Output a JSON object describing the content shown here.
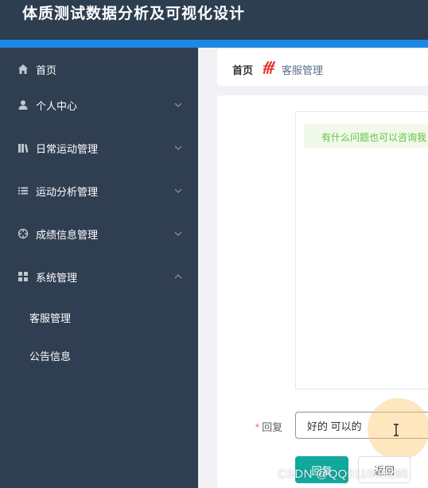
{
  "header": {
    "title": "体质测试数据分析及可视化设计"
  },
  "sidebar": {
    "items": [
      {
        "label": "首页",
        "icon": "home-icon"
      },
      {
        "label": "个人中心",
        "icon": "user-icon"
      },
      {
        "label": "日常运动管理",
        "icon": "books-icon"
      },
      {
        "label": "运动分析管理",
        "icon": "list-icon"
      },
      {
        "label": "成绩信息管理",
        "icon": "crosshair-icon"
      },
      {
        "label": "系统管理",
        "icon": "grid-icon"
      }
    ],
    "subitems": [
      {
        "label": "客服管理"
      },
      {
        "label": "公告信息"
      }
    ]
  },
  "breadcrumb": {
    "home": "首页",
    "separator_icon": "decorative-separator-icon",
    "current": "客服管理"
  },
  "chat": {
    "message": "有什么问题也可以咨询我"
  },
  "form": {
    "reply_label": "回复",
    "reply_value": "好的 可以的",
    "required_mark": "*"
  },
  "buttons": {
    "reply": "回复",
    "back": "返回"
  },
  "watermark": "CSDN @QQ511008285",
  "colors": {
    "header": "#2c3e50",
    "accent_bar": "#1e88e5",
    "sidebar": "#2f3e51",
    "primary_button": "#13a89e",
    "success_text": "#67c23a"
  }
}
